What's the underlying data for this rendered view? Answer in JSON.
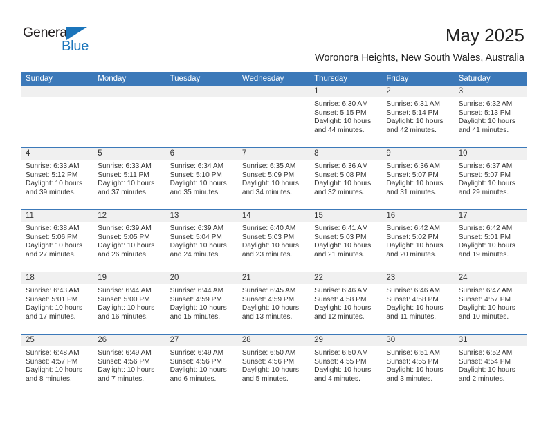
{
  "brand": {
    "name_top": "General",
    "name_bottom": "Blue",
    "accent_color": "#1b75bb"
  },
  "header": {
    "month_title": "May 2025",
    "location": "Woronora Heights, New South Wales, Australia"
  },
  "calendar": {
    "header_color": "#3c79b9",
    "daynum_band_color": "#f0f0f0",
    "weekdays": [
      "Sunday",
      "Monday",
      "Tuesday",
      "Wednesday",
      "Thursday",
      "Friday",
      "Saturday"
    ],
    "weeks": [
      [
        {
          "day": "",
          "empty": true,
          "sunrise": "",
          "sunset": "",
          "daylight1": "",
          "daylight2": ""
        },
        {
          "day": "",
          "empty": true,
          "sunrise": "",
          "sunset": "",
          "daylight1": "",
          "daylight2": ""
        },
        {
          "day": "",
          "empty": true,
          "sunrise": "",
          "sunset": "",
          "daylight1": "",
          "daylight2": ""
        },
        {
          "day": "",
          "empty": true,
          "sunrise": "",
          "sunset": "",
          "daylight1": "",
          "daylight2": ""
        },
        {
          "day": "1",
          "empty": false,
          "sunrise": "Sunrise: 6:30 AM",
          "sunset": "Sunset: 5:15 PM",
          "daylight1": "Daylight: 10 hours",
          "daylight2": "and 44 minutes."
        },
        {
          "day": "2",
          "empty": false,
          "sunrise": "Sunrise: 6:31 AM",
          "sunset": "Sunset: 5:14 PM",
          "daylight1": "Daylight: 10 hours",
          "daylight2": "and 42 minutes."
        },
        {
          "day": "3",
          "empty": false,
          "sunrise": "Sunrise: 6:32 AM",
          "sunset": "Sunset: 5:13 PM",
          "daylight1": "Daylight: 10 hours",
          "daylight2": "and 41 minutes."
        }
      ],
      [
        {
          "day": "4",
          "empty": false,
          "sunrise": "Sunrise: 6:33 AM",
          "sunset": "Sunset: 5:12 PM",
          "daylight1": "Daylight: 10 hours",
          "daylight2": "and 39 minutes."
        },
        {
          "day": "5",
          "empty": false,
          "sunrise": "Sunrise: 6:33 AM",
          "sunset": "Sunset: 5:11 PM",
          "daylight1": "Daylight: 10 hours",
          "daylight2": "and 37 minutes."
        },
        {
          "day": "6",
          "empty": false,
          "sunrise": "Sunrise: 6:34 AM",
          "sunset": "Sunset: 5:10 PM",
          "daylight1": "Daylight: 10 hours",
          "daylight2": "and 35 minutes."
        },
        {
          "day": "7",
          "empty": false,
          "sunrise": "Sunrise: 6:35 AM",
          "sunset": "Sunset: 5:09 PM",
          "daylight1": "Daylight: 10 hours",
          "daylight2": "and 34 minutes."
        },
        {
          "day": "8",
          "empty": false,
          "sunrise": "Sunrise: 6:36 AM",
          "sunset": "Sunset: 5:08 PM",
          "daylight1": "Daylight: 10 hours",
          "daylight2": "and 32 minutes."
        },
        {
          "day": "9",
          "empty": false,
          "sunrise": "Sunrise: 6:36 AM",
          "sunset": "Sunset: 5:07 PM",
          "daylight1": "Daylight: 10 hours",
          "daylight2": "and 31 minutes."
        },
        {
          "day": "10",
          "empty": false,
          "sunrise": "Sunrise: 6:37 AM",
          "sunset": "Sunset: 5:07 PM",
          "daylight1": "Daylight: 10 hours",
          "daylight2": "and 29 minutes."
        }
      ],
      [
        {
          "day": "11",
          "empty": false,
          "sunrise": "Sunrise: 6:38 AM",
          "sunset": "Sunset: 5:06 PM",
          "daylight1": "Daylight: 10 hours",
          "daylight2": "and 27 minutes."
        },
        {
          "day": "12",
          "empty": false,
          "sunrise": "Sunrise: 6:39 AM",
          "sunset": "Sunset: 5:05 PM",
          "daylight1": "Daylight: 10 hours",
          "daylight2": "and 26 minutes."
        },
        {
          "day": "13",
          "empty": false,
          "sunrise": "Sunrise: 6:39 AM",
          "sunset": "Sunset: 5:04 PM",
          "daylight1": "Daylight: 10 hours",
          "daylight2": "and 24 minutes."
        },
        {
          "day": "14",
          "empty": false,
          "sunrise": "Sunrise: 6:40 AM",
          "sunset": "Sunset: 5:03 PM",
          "daylight1": "Daylight: 10 hours",
          "daylight2": "and 23 minutes."
        },
        {
          "day": "15",
          "empty": false,
          "sunrise": "Sunrise: 6:41 AM",
          "sunset": "Sunset: 5:03 PM",
          "daylight1": "Daylight: 10 hours",
          "daylight2": "and 21 minutes."
        },
        {
          "day": "16",
          "empty": false,
          "sunrise": "Sunrise: 6:42 AM",
          "sunset": "Sunset: 5:02 PM",
          "daylight1": "Daylight: 10 hours",
          "daylight2": "and 20 minutes."
        },
        {
          "day": "17",
          "empty": false,
          "sunrise": "Sunrise: 6:42 AM",
          "sunset": "Sunset: 5:01 PM",
          "daylight1": "Daylight: 10 hours",
          "daylight2": "and 19 minutes."
        }
      ],
      [
        {
          "day": "18",
          "empty": false,
          "sunrise": "Sunrise: 6:43 AM",
          "sunset": "Sunset: 5:01 PM",
          "daylight1": "Daylight: 10 hours",
          "daylight2": "and 17 minutes."
        },
        {
          "day": "19",
          "empty": false,
          "sunrise": "Sunrise: 6:44 AM",
          "sunset": "Sunset: 5:00 PM",
          "daylight1": "Daylight: 10 hours",
          "daylight2": "and 16 minutes."
        },
        {
          "day": "20",
          "empty": false,
          "sunrise": "Sunrise: 6:44 AM",
          "sunset": "Sunset: 4:59 PM",
          "daylight1": "Daylight: 10 hours",
          "daylight2": "and 15 minutes."
        },
        {
          "day": "21",
          "empty": false,
          "sunrise": "Sunrise: 6:45 AM",
          "sunset": "Sunset: 4:59 PM",
          "daylight1": "Daylight: 10 hours",
          "daylight2": "and 13 minutes."
        },
        {
          "day": "22",
          "empty": false,
          "sunrise": "Sunrise: 6:46 AM",
          "sunset": "Sunset: 4:58 PM",
          "daylight1": "Daylight: 10 hours",
          "daylight2": "and 12 minutes."
        },
        {
          "day": "23",
          "empty": false,
          "sunrise": "Sunrise: 6:46 AM",
          "sunset": "Sunset: 4:58 PM",
          "daylight1": "Daylight: 10 hours",
          "daylight2": "and 11 minutes."
        },
        {
          "day": "24",
          "empty": false,
          "sunrise": "Sunrise: 6:47 AM",
          "sunset": "Sunset: 4:57 PM",
          "daylight1": "Daylight: 10 hours",
          "daylight2": "and 10 minutes."
        }
      ],
      [
        {
          "day": "25",
          "empty": false,
          "sunrise": "Sunrise: 6:48 AM",
          "sunset": "Sunset: 4:57 PM",
          "daylight1": "Daylight: 10 hours",
          "daylight2": "and 8 minutes."
        },
        {
          "day": "26",
          "empty": false,
          "sunrise": "Sunrise: 6:49 AM",
          "sunset": "Sunset: 4:56 PM",
          "daylight1": "Daylight: 10 hours",
          "daylight2": "and 7 minutes."
        },
        {
          "day": "27",
          "empty": false,
          "sunrise": "Sunrise: 6:49 AM",
          "sunset": "Sunset: 4:56 PM",
          "daylight1": "Daylight: 10 hours",
          "daylight2": "and 6 minutes."
        },
        {
          "day": "28",
          "empty": false,
          "sunrise": "Sunrise: 6:50 AM",
          "sunset": "Sunset: 4:56 PM",
          "daylight1": "Daylight: 10 hours",
          "daylight2": "and 5 minutes."
        },
        {
          "day": "29",
          "empty": false,
          "sunrise": "Sunrise: 6:50 AM",
          "sunset": "Sunset: 4:55 PM",
          "daylight1": "Daylight: 10 hours",
          "daylight2": "and 4 minutes."
        },
        {
          "day": "30",
          "empty": false,
          "sunrise": "Sunrise: 6:51 AM",
          "sunset": "Sunset: 4:55 PM",
          "daylight1": "Daylight: 10 hours",
          "daylight2": "and 3 minutes."
        },
        {
          "day": "31",
          "empty": false,
          "sunrise": "Sunrise: 6:52 AM",
          "sunset": "Sunset: 4:54 PM",
          "daylight1": "Daylight: 10 hours",
          "daylight2": "and 2 minutes."
        }
      ]
    ]
  }
}
